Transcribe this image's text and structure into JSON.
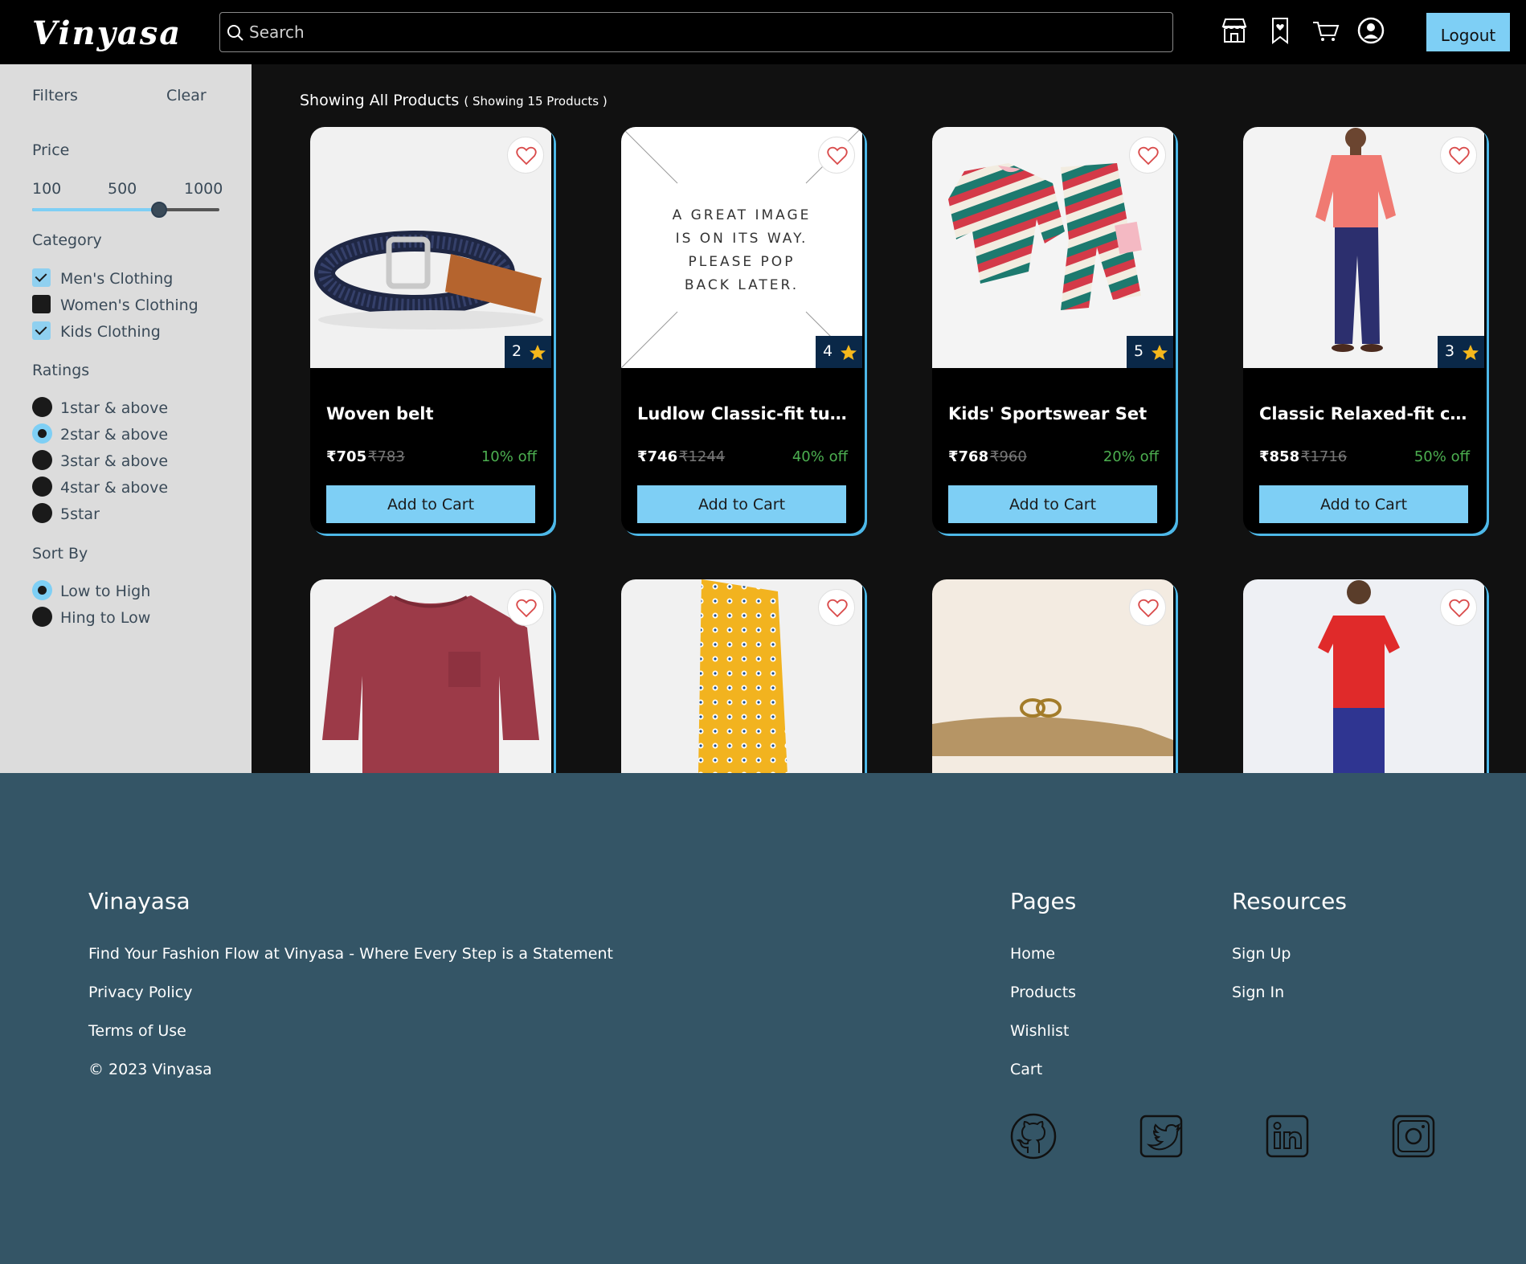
{
  "header": {
    "logo": "Vinyasa",
    "search_placeholder": "Search",
    "icons": [
      "store-icon",
      "wishlist-bookmark-icon",
      "cart-icon",
      "account-icon"
    ],
    "logout_label": "Logout"
  },
  "sidebar": {
    "filters_label": "Filters",
    "clear_label": "Clear",
    "price_label": "Price",
    "price_ticks": [
      "100",
      "500",
      "1000"
    ],
    "price_value_fraction": 0.68,
    "category_label": "Category",
    "categories": [
      {
        "label": "Men's Clothing",
        "checked": true
      },
      {
        "label": "Women's Clothing",
        "checked": false
      },
      {
        "label": "Kids Clothing",
        "checked": true
      }
    ],
    "ratings_label": "Ratings",
    "ratings": [
      {
        "label": "1star & above",
        "checked": false
      },
      {
        "label": "2star & above",
        "checked": true
      },
      {
        "label": "3star & above",
        "checked": false
      },
      {
        "label": "4star & above",
        "checked": false
      },
      {
        "label": "5star",
        "checked": false
      }
    ],
    "sort_label": "Sort By",
    "sort_options": [
      {
        "label": "Low to High",
        "checked": true
      },
      {
        "label": "Hing to Low",
        "checked": false
      }
    ]
  },
  "main": {
    "showing_title": "Showing All Products",
    "showing_count": "( Showing 15 Products )",
    "add_to_cart_label": "Add to Cart",
    "placeholder_text": [
      "A GREAT IMAGE",
      "IS ON ITS WAY.",
      "PLEASE POP",
      "BACK LATER."
    ],
    "products": [
      {
        "name": "Woven belt",
        "price": "₹705",
        "old_price": "₹783",
        "discount": "10% off",
        "rating": "2"
      },
      {
        "name": "Ludlow Classic-fit tuxedo jacket",
        "price": "₹746",
        "old_price": "₹1244",
        "discount": "40% off",
        "rating": "4"
      },
      {
        "name": "Kids' Sportswear Set",
        "price": "₹768",
        "old_price": "₹960",
        "discount": "20% off",
        "rating": "5"
      },
      {
        "name": "Classic Relaxed-fit chino pant",
        "price": "₹858",
        "old_price": "₹1716",
        "discount": "50% off",
        "rating": "3"
      },
      {
        "name": "",
        "price": "",
        "old_price": "",
        "discount": "",
        "rating": ""
      },
      {
        "name": "",
        "price": "",
        "old_price": "",
        "discount": "",
        "rating": ""
      },
      {
        "name": "",
        "price": "",
        "old_price": "",
        "discount": "",
        "rating": ""
      },
      {
        "name": "",
        "price": "",
        "old_price": "",
        "discount": "",
        "rating": ""
      }
    ]
  },
  "footer": {
    "brand": "Vinayasa",
    "tagline": "Find Your Fashion Flow at Vinyasa - Where Every Step is a Statement",
    "privacy": "Privacy Policy",
    "terms": "Terms of Use",
    "copyright": "© 2023 Vinyasa",
    "pages_title": "Pages",
    "pages": [
      "Home",
      "Products",
      "Wishlist",
      "Cart"
    ],
    "resources_title": "Resources",
    "resources": [
      "Sign Up",
      "Sign In"
    ],
    "social_icons": [
      "github-icon",
      "twitter-icon",
      "linkedin-icon",
      "instagram-icon"
    ]
  },
  "colors": {
    "accent": "#7ecff5",
    "discount": "#4caf50",
    "footer_bg": "#345566",
    "sidebar_bg": "#dcdcdc",
    "rating_badge": "#0a2848",
    "star": "#f5b81c"
  }
}
